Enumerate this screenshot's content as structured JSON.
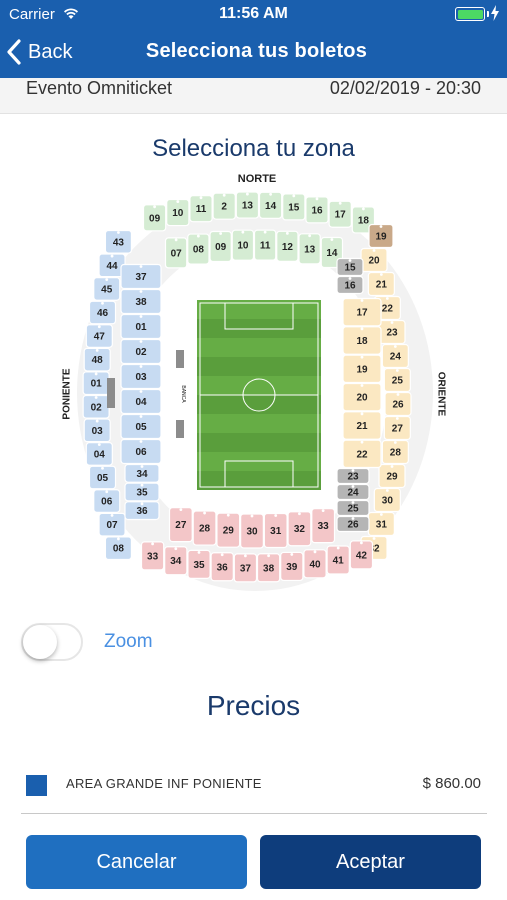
{
  "status_bar": {
    "carrier": "Carrier",
    "time": "11:56 AM",
    "battery_level": 1.0
  },
  "nav": {
    "back_label": "Back",
    "title": "Selecciona tus boletos"
  },
  "event": {
    "name": "Evento Omniticket",
    "datetime": "02/02/2019 - 20:30"
  },
  "zone_title": "Selecciona tu zona",
  "stadium": {
    "side_labels": {
      "north": "NORTE",
      "west": "PONIENTE",
      "east": "ORIENTE",
      "center_tag": "BANCA"
    },
    "outer_top": [
      "09",
      "10",
      "11",
      "2",
      "13",
      "14",
      "15",
      "16",
      "17",
      "18"
    ],
    "outer_ne": [
      "19"
    ],
    "outer_east": [
      "20",
      "21",
      "22",
      "23",
      "24",
      "25",
      "26",
      "27",
      "28",
      "29",
      "30",
      "31",
      "32"
    ],
    "outer_bottom": [
      "33",
      "34",
      "35",
      "36",
      "37",
      "38",
      "39",
      "40",
      "41",
      "42"
    ],
    "outer_west": [
      "43",
      "44",
      "45",
      "46",
      "47",
      "48",
      "01",
      "02",
      "03",
      "04",
      "05",
      "06",
      "07",
      "08"
    ],
    "inner_top": [
      "07",
      "08",
      "09",
      "10",
      "11",
      "12",
      "13",
      "14"
    ],
    "inner_ne": [
      "15",
      "16"
    ],
    "inner_east": [
      "17",
      "18",
      "19",
      "20",
      "21",
      "22"
    ],
    "inner_se": [
      "23",
      "24",
      "25",
      "26"
    ],
    "inner_bottom": [
      "27",
      "28",
      "29",
      "30",
      "31",
      "32",
      "33"
    ],
    "inner_sw": [
      "34",
      "35",
      "36"
    ],
    "inner_west": [
      "37",
      "38",
      "01",
      "02",
      "03",
      "04",
      "05",
      "06"
    ]
  },
  "zoom": {
    "label": "Zoom",
    "enabled": false
  },
  "prices": {
    "title": "Precios",
    "items": [
      {
        "label": "AREA GRANDE INF PONIENTE",
        "price": "$ 860.00",
        "color": "#1a5fae"
      }
    ]
  },
  "buttons": {
    "cancel": "Cancelar",
    "accept": "Aceptar"
  },
  "colors": {
    "primary": "#1a5fae",
    "accept": "#0e3d7c",
    "north": "#d5ecd3",
    "east": "#fbe8c2",
    "south": "#f3c6c8",
    "west": "#c7dbf2",
    "corner_gray": "#b5b5b5",
    "pitch": "#5a9e3c"
  }
}
